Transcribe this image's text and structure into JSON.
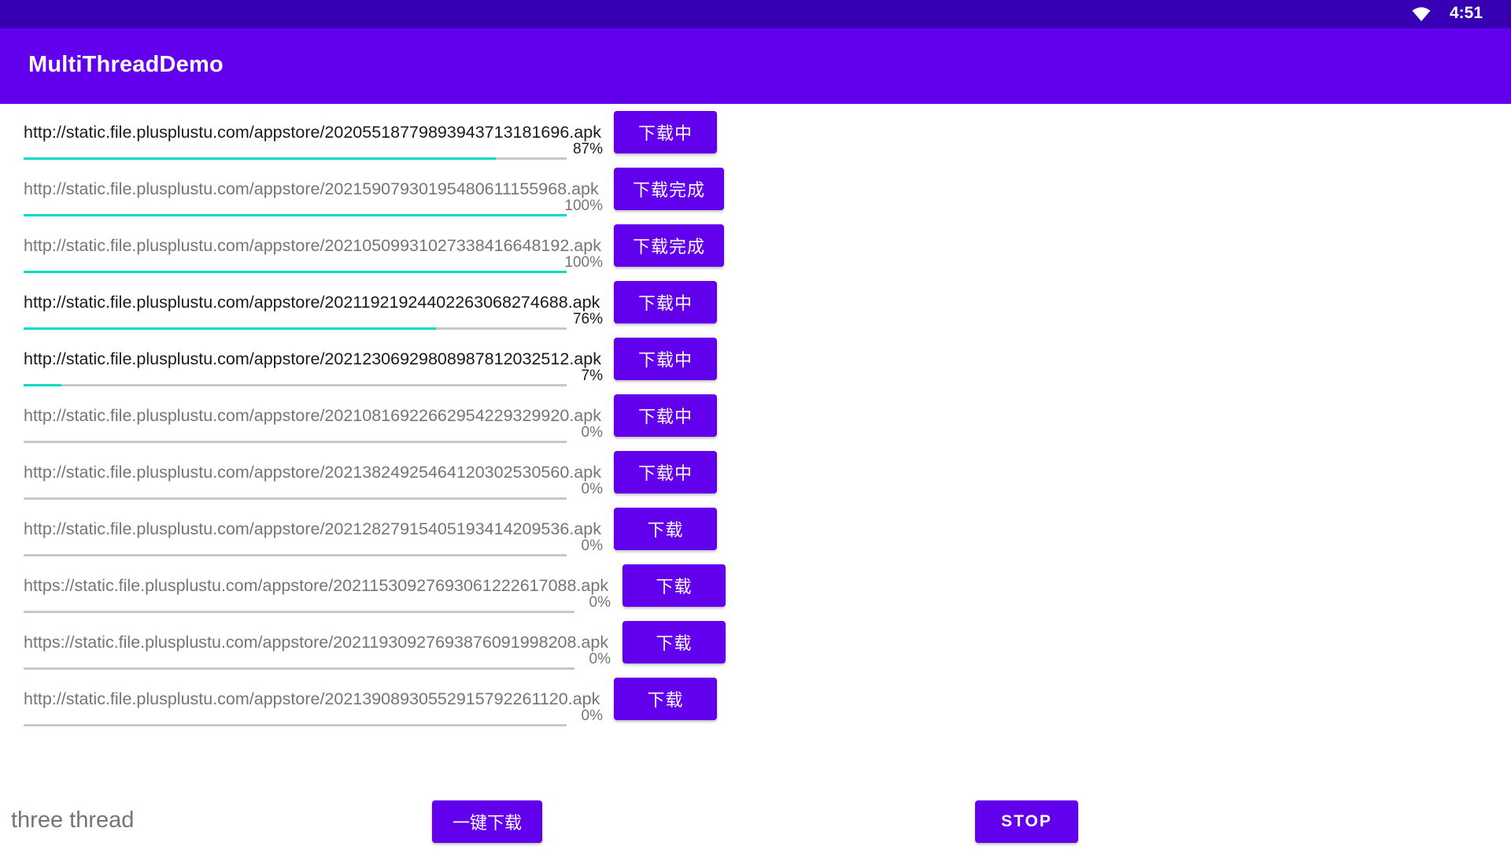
{
  "status_bar": {
    "time": "4:51",
    "icon": "wifi-icon"
  },
  "app_bar": {
    "title": "MultiThreadDemo"
  },
  "downloads": [
    {
      "url": "http://static.file.plusplustu.com/appstore/2020551877989394371318169​6.apk",
      "percent_label": "87%",
      "progress": 0.87,
      "button": "下载中",
      "active": true
    },
    {
      "url": "http://static.file.plusplustu.com/appstore/20215907930195480611155968.apk",
      "percent_label": "100%",
      "progress": 1.0,
      "button": "下载完成",
      "active": false
    },
    {
      "url": "http://static.file.plusplustu.com/appstore/20210509931027338416648192.apk",
      "percent_label": "100%",
      "progress": 1.0,
      "button": "下载完成",
      "active": false
    },
    {
      "url": "http://static.file.plusplustu.com/appstore/20211921924402263068274688.apk",
      "percent_label": "76%",
      "progress": 0.76,
      "button": "下载中",
      "active": true
    },
    {
      "url": "http://static.file.plusplustu.com/appstore/20212306929808987812032512.apk",
      "percent_label": "7%",
      "progress": 0.07,
      "button": "下载中",
      "active": true
    },
    {
      "url": "http://static.file.plusplustu.com/appstore/20210816922662954229329920.apk",
      "percent_label": "0%",
      "progress": 0,
      "button": "下载中",
      "active": false
    },
    {
      "url": "http://static.file.plusplustu.com/appstore/20213824925464120302530560.apk",
      "percent_label": "0%",
      "progress": 0,
      "button": "下载中",
      "active": false
    },
    {
      "url": "http://static.file.plusplustu.com/appstore/20212827915405193414209536.apk",
      "percent_label": "0%",
      "progress": 0,
      "button": "下载",
      "active": false
    },
    {
      "url": "https://static.file.plusplustu.com/appstore/20211530927693061222617088.apk",
      "percent_label": "0%",
      "progress": 0,
      "button": "下载",
      "active": false
    },
    {
      "url": "https://static.file.plusplustu.com/appstore/20211930927693876091998208.apk",
      "percent_label": "0%",
      "progress": 0,
      "button": "下载",
      "active": false
    },
    {
      "url": "http://static.file.plusplustu.com/appstore/20213908930552915792261120.apk",
      "percent_label": "0%",
      "progress": 0,
      "button": "下载",
      "active": false
    }
  ],
  "footer": {
    "label": "three thread",
    "download_all": "一键下载",
    "stop": "STOP"
  },
  "colors": {
    "status_bar": "#3700b3",
    "app_bar": "#6200ee",
    "button": "#6200ee",
    "progress_fill": "#03dac5",
    "progress_track": "#c8c8c8"
  }
}
